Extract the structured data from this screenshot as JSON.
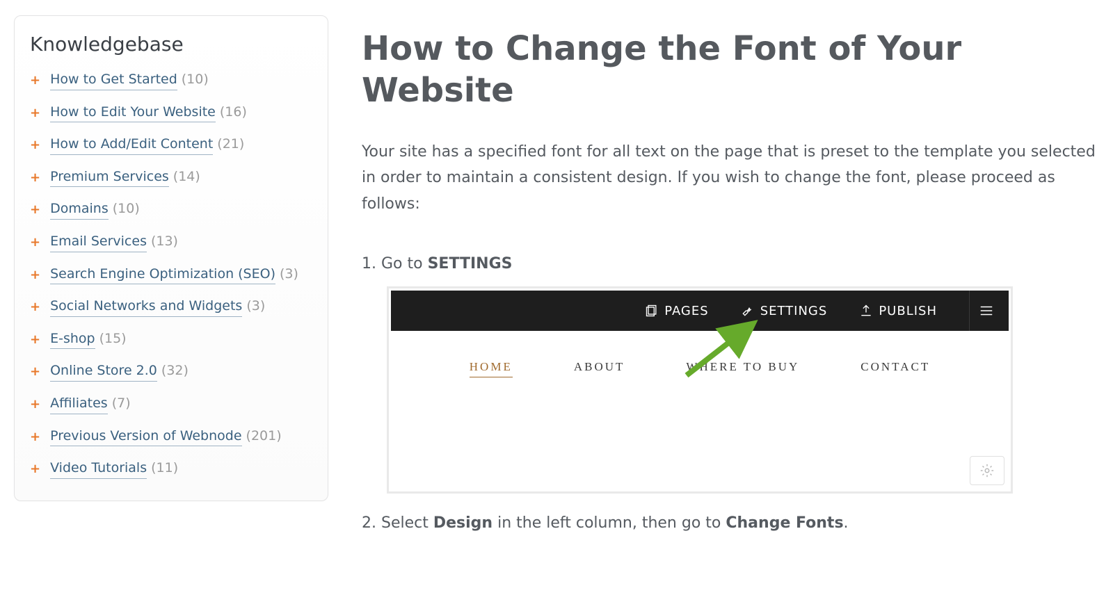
{
  "sidebar": {
    "title": "Knowledgebase",
    "items": [
      {
        "label": "How to Get Started",
        "count": "(10)"
      },
      {
        "label": "How to Edit Your Website",
        "count": "(16)"
      },
      {
        "label": "How to Add/Edit Content",
        "count": "(21)"
      },
      {
        "label": "Premium Services",
        "count": "(14)"
      },
      {
        "label": "Domains",
        "count": "(10)"
      },
      {
        "label": "Email Services",
        "count": "(13)"
      },
      {
        "label": "Search Engine Optimization (SEO)",
        "count": "(3)"
      },
      {
        "label": "Social Networks and Widgets",
        "count": "(3)"
      },
      {
        "label": "E-shop",
        "count": "(15)"
      },
      {
        "label": "Online Store 2.0",
        "count": "(32)"
      },
      {
        "label": "Affiliates",
        "count": "(7)"
      },
      {
        "label": "Previous Version of Webnode",
        "count": "(201)"
      },
      {
        "label": "Video Tutorials",
        "count": "(11)"
      }
    ]
  },
  "article": {
    "title": "How to Change the Font of Your Website",
    "lead": "Your site has a specified font for all text on the page that is preset to the template you selected in order to maintain a consistent design. If you wish to change the font, please proceed as follows:",
    "step1_prefix": "1. Go to ",
    "step1_bold": "SETTINGS",
    "step2_prefix": "2. Select ",
    "step2_bold1": "Design",
    "step2_mid": " in the left column, then go to ",
    "step2_bold2": "Change Fonts",
    "step2_suffix": "."
  },
  "shot": {
    "topbar": {
      "pages": "PAGES",
      "settings": "SETTINGS",
      "publish": "PUBLISH"
    },
    "nav": {
      "home": "HOME",
      "about": "ABOUT",
      "where": "WHERE TO BUY",
      "contact": "CONTACT"
    }
  }
}
